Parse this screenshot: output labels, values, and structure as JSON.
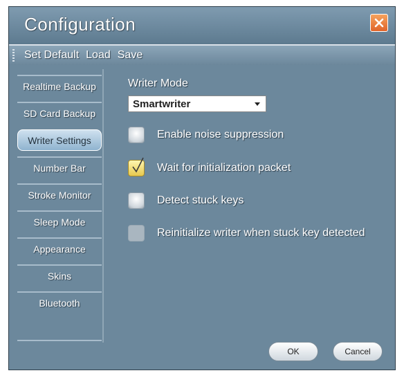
{
  "window": {
    "title": "Configuration"
  },
  "menubar": {
    "items": [
      "Set Default",
      "Load",
      "Save"
    ]
  },
  "sidebar": {
    "items": [
      {
        "label": "Realtime Backup",
        "active": false
      },
      {
        "label": "SD Card Backup",
        "active": false
      },
      {
        "label": "Writer Settings",
        "active": true
      },
      {
        "label": "Number Bar",
        "active": false
      },
      {
        "label": "Stroke Monitor",
        "active": false
      },
      {
        "label": "Sleep Mode",
        "active": false
      },
      {
        "label": "Appearance",
        "active": false
      },
      {
        "label": "Skins",
        "active": false
      },
      {
        "label": "Bluetooth",
        "active": false
      }
    ]
  },
  "writer_settings": {
    "mode_label": "Writer Mode",
    "mode_value": "Smartwriter",
    "options": [
      {
        "label": "Enable noise suppression",
        "checked": false,
        "enabled": true
      },
      {
        "label": "Wait for initialization packet",
        "checked": true,
        "enabled": true
      },
      {
        "label": "Detect stuck keys",
        "checked": false,
        "enabled": true
      },
      {
        "label": "Reinitialize writer when stuck key detected",
        "checked": false,
        "enabled": false
      }
    ]
  },
  "buttons": {
    "ok": "OK",
    "cancel": "Cancel"
  },
  "colors": {
    "accent_close": "#e0642a",
    "panel": "#6c889c",
    "active_tab": "#cfe1ef"
  },
  "icons": {
    "close": "close-icon",
    "checkmark": "checkmark-icon",
    "dropdown": "chevron-down-icon"
  }
}
